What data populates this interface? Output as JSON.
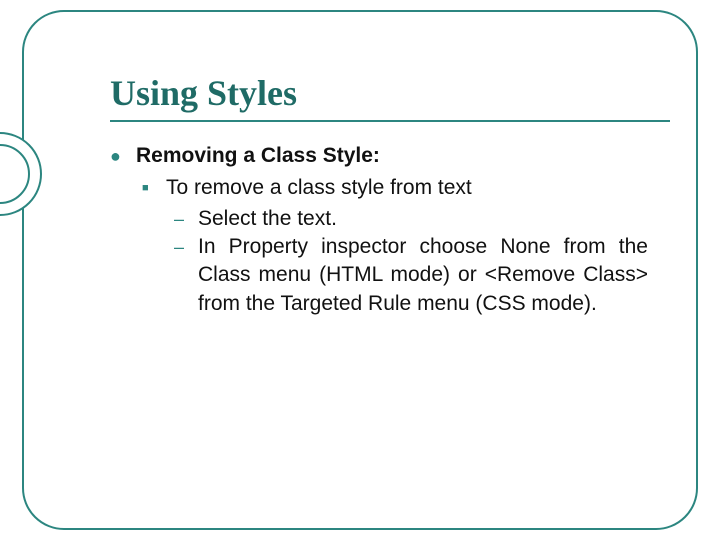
{
  "slide": {
    "title": "Using Styles",
    "level1": "Removing a Class Style:",
    "level2": "To remove a class style from text",
    "level3a": "Select the text.",
    "level3b": "In Property inspector choose None from the Class menu (HTML mode) or <Remove Class> from the Targeted Rule menu (CSS mode)."
  }
}
